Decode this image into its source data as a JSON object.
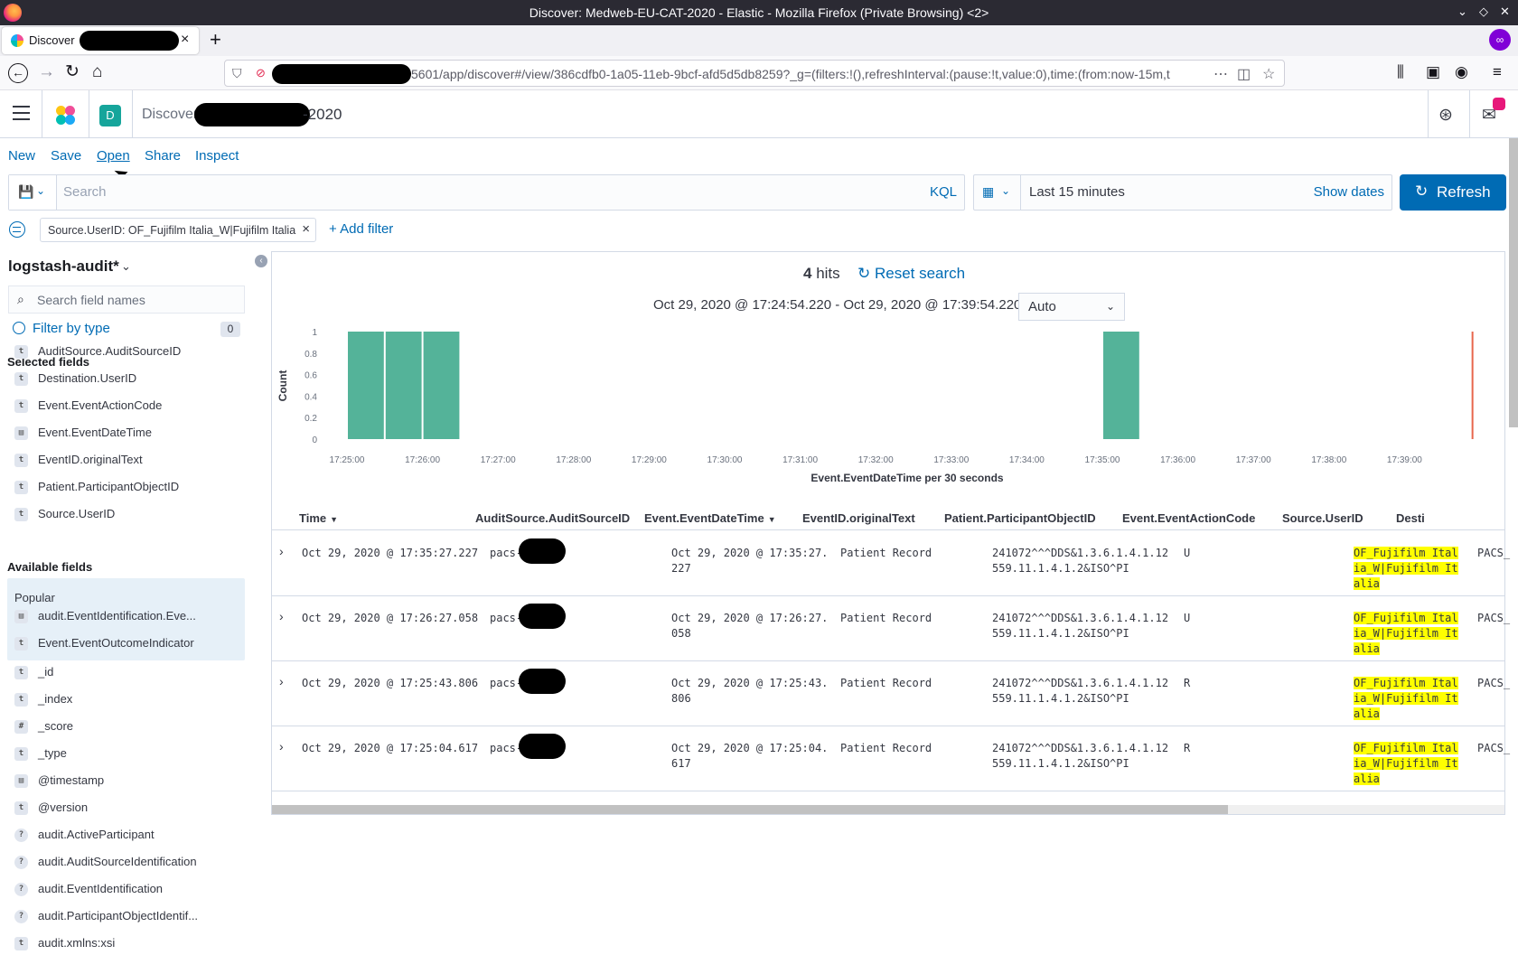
{
  "browser": {
    "window_title": "Discover: Medweb-EU-CAT-2020 - Elastic - Mozilla Firefox (Private Browsing) <2>",
    "tab_label": "Discover",
    "url": "5601/app/discover#/view/386cdfb0-1a05-11eb-9bcf-afd5d5db8259?_g=(filters:!(),refreshInterval:(pause:!t,value:0),time:(from:now-15m,t",
    "private_badge": "∞"
  },
  "kibana": {
    "space_initial": "D",
    "breadcrumb": "Discover",
    "title_suffix": "-2020"
  },
  "top_menu": [
    "New",
    "Save",
    "Open",
    "Share",
    "Inspect"
  ],
  "query": {
    "placeholder": "Search",
    "language": "KQL",
    "time_range": "Last 15 minutes",
    "show_dates": "Show dates",
    "refresh_label": "Refresh"
  },
  "filter": {
    "pill": "Source.UserID: OF_Fujifilm Italia_W|Fujifilm Italia",
    "add_filter": "+ Add filter"
  },
  "sidebar": {
    "index_pattern": "logstash-audit*",
    "search_placeholder": "Search field names",
    "filter_by_type": "Filter by type",
    "filter_count": "0",
    "selected_title": "Selected fields",
    "selected_fields": [
      {
        "type": "t",
        "name": "AuditSource.AuditSourceID"
      },
      {
        "type": "t",
        "name": "Destination.UserID"
      },
      {
        "type": "t",
        "name": "Event.EventActionCode"
      },
      {
        "type": "date",
        "name": "Event.EventDateTime"
      },
      {
        "type": "t",
        "name": "EventID.originalText"
      },
      {
        "type": "t",
        "name": "Patient.ParticipantObjectID"
      },
      {
        "type": "t",
        "name": "Source.UserID"
      }
    ],
    "available_title": "Available fields",
    "popular_title": "Popular",
    "popular_fields": [
      {
        "type": "date",
        "name": "audit.EventIdentification.Eve..."
      },
      {
        "type": "t",
        "name": "Event.EventOutcomeIndicator"
      }
    ],
    "available_fields": [
      {
        "type": "t",
        "name": "_id"
      },
      {
        "type": "t",
        "name": "_index"
      },
      {
        "type": "#",
        "name": "_score"
      },
      {
        "type": "t",
        "name": "_type"
      },
      {
        "type": "date",
        "name": "@timestamp"
      },
      {
        "type": "t",
        "name": "@version"
      },
      {
        "type": "?",
        "name": "audit.ActiveParticipant"
      },
      {
        "type": "?",
        "name": "audit.AuditSourceIdentification"
      },
      {
        "type": "?",
        "name": "audit.EventIdentification"
      },
      {
        "type": "?",
        "name": "audit.ParticipantObjectIdentif..."
      },
      {
        "type": "t",
        "name": "audit.xmlns:xsi"
      }
    ]
  },
  "results": {
    "hits_count": "4",
    "hits_label": "hits",
    "reset_search": "Reset search",
    "range_text": "Oct 29, 2020 @ 17:24:54.220 - Oct 29, 2020 @ 17:39:54.220",
    "interval": "Auto"
  },
  "chart_data": {
    "type": "bar",
    "xlabel": "Event.EventDateTime per 30 seconds",
    "ylabel": "Count",
    "ylim": [
      0,
      1
    ],
    "yticks": [
      "0",
      "0.2",
      "0.4",
      "0.6",
      "0.8",
      "1"
    ],
    "xticks": [
      "17:25:00",
      "17:26:00",
      "17:27:00",
      "17:28:00",
      "17:29:00",
      "17:30:00",
      "17:31:00",
      "17:32:00",
      "17:33:00",
      "17:34:00",
      "17:35:00",
      "17:36:00",
      "17:37:00",
      "17:38:00",
      "17:39:00"
    ],
    "bars": [
      {
        "x": "17:25:00",
        "value": 1
      },
      {
        "x": "17:25:30",
        "value": 1
      },
      {
        "x": "17:26:00",
        "value": 1
      },
      {
        "x": "17:35:00",
        "value": 1
      }
    ],
    "now_marker": "17:39:54",
    "bar_color": "#54b399",
    "marker_color": "#e7664c"
  },
  "table": {
    "columns": [
      "Time",
      "AuditSource.AuditSourceID",
      "Event.EventDateTime",
      "EventID.originalText",
      "Patient.ParticipantObjectID",
      "Event.EventActionCode",
      "Source.UserID",
      "Desti"
    ],
    "rows": [
      {
        "time": "Oct 29, 2020 @ 17:35:27.227",
        "source": "pacs-",
        "datetime1": "Oct 29, 2020 @ 17:35:27.",
        "datetime2": "227",
        "text": "Patient Record",
        "pid1": "241072^^^DDS&1.3.6.1.4.1.12",
        "pid2": "559.11.1.4.1.2&ISO^PI",
        "action": "U",
        "user1": "OF_Fujifilm Ital",
        "user2": "ia_W|Fujifilm It",
        "user3": "alia",
        "dest": "PACS_"
      },
      {
        "time": "Oct 29, 2020 @ 17:26:27.058",
        "source": "pacs-",
        "datetime1": "Oct 29, 2020 @ 17:26:27.",
        "datetime2": "058",
        "text": "Patient Record",
        "pid1": "241072^^^DDS&1.3.6.1.4.1.12",
        "pid2": "559.11.1.4.1.2&ISO^PI",
        "action": "U",
        "user1": "OF_Fujifilm Ital",
        "user2": "ia_W|Fujifilm It",
        "user3": "alia",
        "dest": "PACS_"
      },
      {
        "time": "Oct 29, 2020 @ 17:25:43.806",
        "source": "pacs-",
        "datetime1": "Oct 29, 2020 @ 17:25:43.",
        "datetime2": "806",
        "text": "Patient Record",
        "pid1": "241072^^^DDS&1.3.6.1.4.1.12",
        "pid2": "559.11.1.4.1.2&ISO^PI",
        "action": "R",
        "user1": "OF_Fujifilm Ital",
        "user2": "ia_W|Fujifilm It",
        "user3": "alia",
        "dest": "PACS_"
      },
      {
        "time": "Oct 29, 2020 @ 17:25:04.617",
        "source": "pacs-",
        "datetime1": "Oct 29, 2020 @ 17:25:04.",
        "datetime2": "617",
        "text": "Patient Record",
        "pid1": "241072^^^DDS&1.3.6.1.4.1.12",
        "pid2": "559.11.1.4.1.2&ISO^PI",
        "action": "R",
        "user1": "OF_Fujifilm Ital",
        "user2": "ia_W|Fujifilm It",
        "user3": "alia",
        "dest": "PACS_"
      }
    ]
  }
}
